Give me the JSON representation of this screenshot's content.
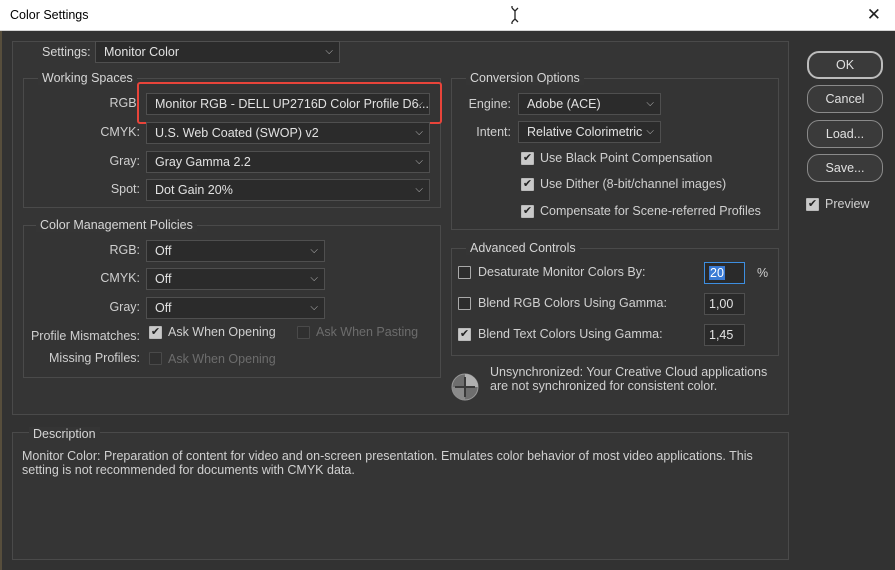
{
  "window": {
    "title": "Color Settings",
    "close_glyph": "✕"
  },
  "settings": {
    "label": "Settings:",
    "value": "Monitor Color"
  },
  "working_spaces": {
    "title": "Working Spaces",
    "rgb": {
      "label": "RGB:",
      "value": "Monitor RGB - DELL UP2716D Color Profile D6..."
    },
    "cmyk": {
      "label": "CMYK:",
      "value": "U.S. Web Coated (SWOP) v2"
    },
    "gray": {
      "label": "Gray:",
      "value": "Gray Gamma 2.2"
    },
    "spot": {
      "label": "Spot:",
      "value": "Dot Gain 20%"
    }
  },
  "policies": {
    "title": "Color Management Policies",
    "rgb": {
      "label": "RGB:",
      "value": "Off"
    },
    "cmyk": {
      "label": "CMYK:",
      "value": "Off"
    },
    "gray": {
      "label": "Gray:",
      "value": "Off"
    },
    "profile_mismatches": {
      "label": "Profile Mismatches:",
      "ask_opening": "Ask When Opening",
      "ask_opening_checked": true,
      "ask_pasting": "Ask When Pasting",
      "ask_pasting_checked": false
    },
    "missing_profiles": {
      "label": "Missing Profiles:",
      "ask_opening": "Ask When Opening",
      "ask_opening_checked": false
    }
  },
  "conversion": {
    "title": "Conversion Options",
    "engine": {
      "label": "Engine:",
      "value": "Adobe (ACE)"
    },
    "intent": {
      "label": "Intent:",
      "value": "Relative Colorimetric"
    },
    "black_point": "Use Black Point Compensation",
    "dither": "Use Dither (8-bit/channel images)",
    "compensate": "Compensate for Scene-referred Profiles"
  },
  "advanced": {
    "title": "Advanced Controls",
    "desaturate": {
      "label": "Desaturate Monitor Colors By:",
      "value": "20",
      "unit": "%",
      "checked": false
    },
    "blend_rgb": {
      "label": "Blend RGB Colors Using Gamma:",
      "value": "1,00",
      "checked": false
    },
    "blend_text": {
      "label": "Blend Text Colors Using Gamma:",
      "value": "1,45",
      "checked": true
    }
  },
  "sync": {
    "line1": "Unsynchronized: Your Creative Cloud applications",
    "line2": "are not synchronized for consistent color."
  },
  "description": {
    "title": "Description",
    "line1": "Monitor Color:  Preparation of content for video and on-screen presentation. Emulates color behavior of most video applications. This",
    "line2": "setting is not recommended for documents with CMYK data."
  },
  "buttons": {
    "ok": "OK",
    "cancel": "Cancel",
    "load": "Load...",
    "save": "Save...",
    "preview": "Preview",
    "preview_checked": true
  },
  "icons": {
    "check": "✔",
    "chevron": "⌄",
    "sync": "color-sync-icon",
    "cursor": "text-cursor-icon"
  },
  "colors": {
    "highlight": "#e8443a",
    "accent": "#3a7bd5",
    "bg": "#323232"
  }
}
